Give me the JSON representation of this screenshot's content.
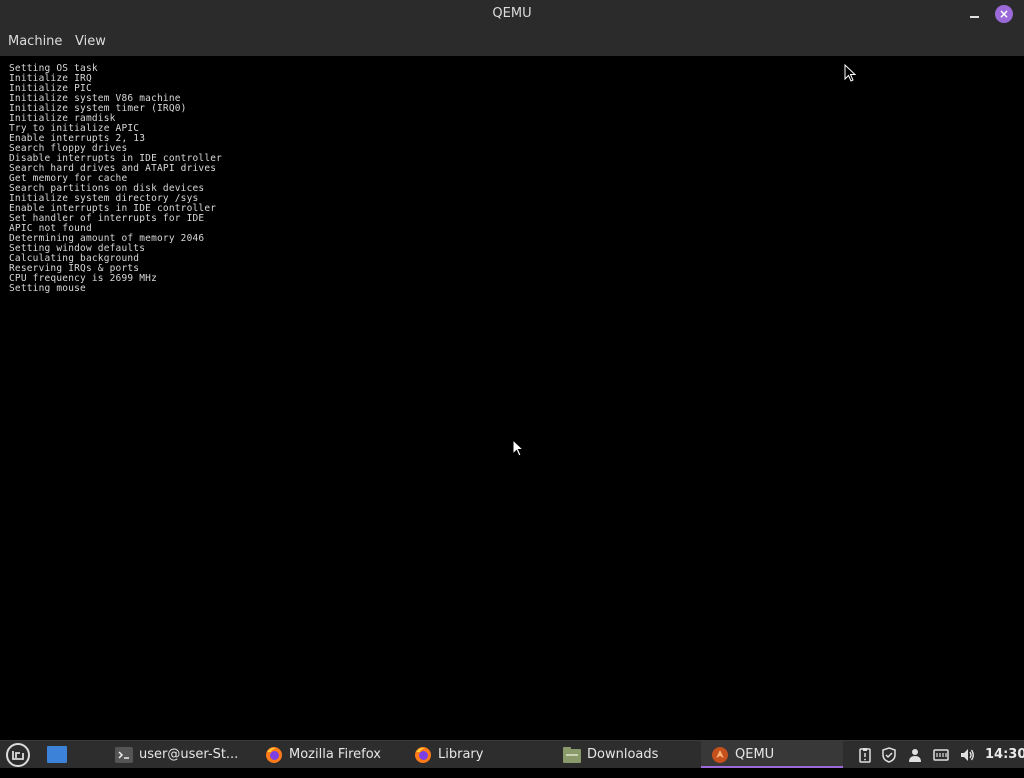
{
  "window": {
    "title": "QEMU",
    "minimize_icon": "minimize-icon",
    "close_icon": "close-icon",
    "close_glyph": "×",
    "accent_color": "#9b6ad8"
  },
  "menubar": {
    "items": [
      {
        "label": "Machine"
      },
      {
        "label": "View"
      }
    ]
  },
  "console": {
    "lines": [
      "Setting OS task",
      "Initialize IRQ",
      "Initialize PIC",
      "Initialize system V86 machine",
      "Initialize system timer (IRQ0)",
      "Initialize ramdisk",
      "Try to initialize APIC",
      "Enable interrupts 2, 13",
      "Search floppy drives",
      "Disable interrupts in IDE controller",
      "Search hard drives and ATAPI drives",
      "Get memory for cache",
      "Search partitions on disk devices",
      "Initialize system directory /sys",
      "Enable interrupts in IDE controller",
      "Set handler of interrupts for IDE",
      "APIC not found",
      "Determining amount of memory 2046",
      "Setting window defaults",
      "Calculating background",
      "Reserving IRQs & ports",
      "CPU frequency is 2699 MHz",
      "Setting mouse"
    ]
  },
  "taskbar": {
    "menu_icon": "mint-menu-icon",
    "show_desktop_icon": "show-desktop-icon",
    "tasks": [
      {
        "label": "user@user-St...",
        "icon": "terminal-icon"
      },
      {
        "label": "Mozilla Firefox",
        "icon": "firefox-icon"
      },
      {
        "label": "Library",
        "icon": "firefox-icon"
      },
      {
        "label": "Downloads",
        "icon": "folder-icon"
      },
      {
        "label": "QEMU",
        "icon": "qemu-icon",
        "active": true
      }
    ],
    "tray_icons": [
      "clipboard-icon",
      "shield-icon",
      "user-icon",
      "network-icon",
      "volume-icon"
    ],
    "clock": "14:30"
  }
}
